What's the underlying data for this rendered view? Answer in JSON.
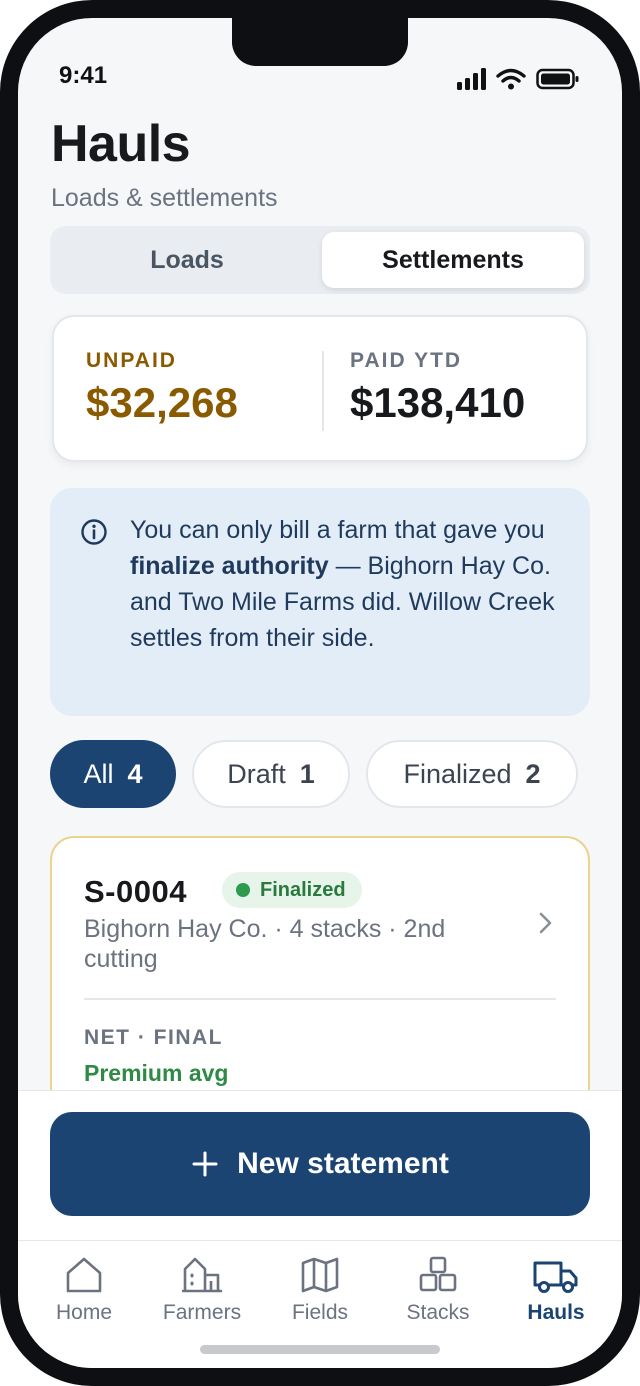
{
  "status_bar": {
    "time": "9:41"
  },
  "header": {
    "title": "Hauls",
    "subtitle": "Loads & settlements"
  },
  "segmented": {
    "loads": "Loads",
    "settlements": "Settlements",
    "selected": "Settlements"
  },
  "summary": {
    "unpaid_label": "UNPAID",
    "unpaid_value": "$32,268",
    "paid_label": "PAID YTD",
    "paid_value": "$138,410",
    "unpaid_color": "#8a5a00"
  },
  "info": {
    "icon": "info-icon",
    "text_before": "You can only bill a farm that gave you ",
    "text_bold": "finalize authority",
    "text_after": " — Bighorn Hay Co. and Two Mile Farms did. Willow Creek settles from their side."
  },
  "filters": [
    {
      "label": "All",
      "count": "4",
      "selected": true
    },
    {
      "label": "Draft",
      "count": "1",
      "selected": false
    },
    {
      "label": "Finalized",
      "count": "2",
      "selected": false
    }
  ],
  "statement": {
    "id": "S-0004",
    "status": "Finalized",
    "status_color": "#2e9a4b",
    "meta": "Bighorn Hay Co. · 4 stacks · 2nd cutting",
    "net_label": "NET · FINAL",
    "premium": "Premium avg"
  },
  "cta": {
    "label": "New statement",
    "icon": "plus-icon"
  },
  "tabs": [
    {
      "label": "Home",
      "icon": "home-icon",
      "active": false
    },
    {
      "label": "Farmers",
      "icon": "barn-icon",
      "active": false
    },
    {
      "label": "Fields",
      "icon": "map-icon",
      "active": false
    },
    {
      "label": "Stacks",
      "icon": "stacks-icon",
      "active": false
    },
    {
      "label": "Hauls",
      "icon": "truck-icon",
      "active": true
    }
  ],
  "colors": {
    "accent": "#1b4472",
    "background": "#f5f7f9"
  }
}
